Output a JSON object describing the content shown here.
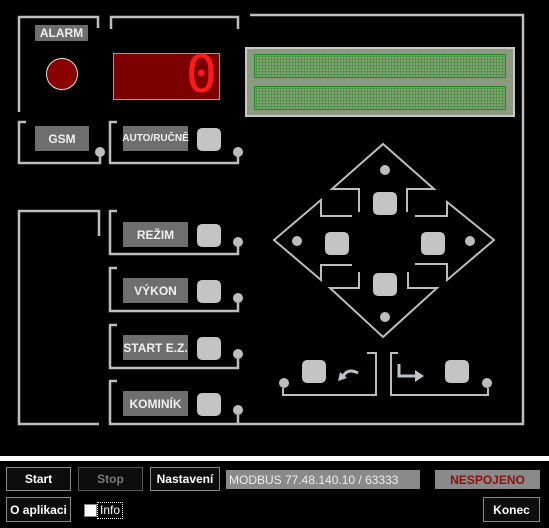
{
  "panel": {
    "alarm_label": "ALARM",
    "alarm_led_color": "#8b0000",
    "display_value": "0",
    "display_color": "#ff1a1a",
    "lcd_lines": [
      "",
      ""
    ],
    "gsm_label": "GSM",
    "auto_label": "AUTO/RUČNĚ",
    "rows": [
      {
        "label": "REŽIM"
      },
      {
        "label": "VÝKON"
      },
      {
        "label": "START E.Z."
      },
      {
        "label": "KOMINÍK"
      }
    ],
    "nav_icons": [
      "arrow-up-icon",
      "arrow-left-icon",
      "arrow-right-icon",
      "arrow-down-icon",
      "undo-icon",
      "enter-icon"
    ]
  },
  "toolbar": {
    "start_label": "Start",
    "stop_label": "Stop",
    "settings_label": "Nastavení",
    "connection": "MODBUS 77.48.140.10 / 63333",
    "status": "NESPOJENO",
    "status_color": "#8b1010",
    "about_label": "O aplikaci",
    "info_label": "Info",
    "info_checked": false,
    "exit_label": "Konec"
  }
}
